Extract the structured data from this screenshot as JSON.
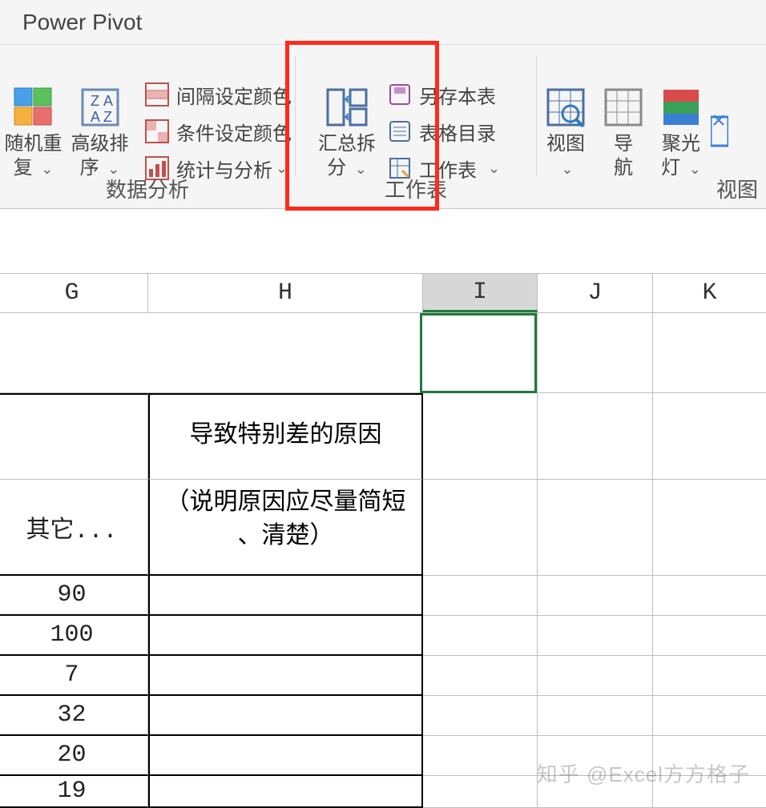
{
  "tab": {
    "title": "Power Pivot"
  },
  "ribbon": {
    "random_repeat": {
      "label": "随机重\n复",
      "dd": "⌄"
    },
    "adv_sort": {
      "label": "高级排\n序",
      "dd": "⌄"
    },
    "interval_color": {
      "label": "间隔设定颜色"
    },
    "cond_color": {
      "label": "条件设定颜色"
    },
    "stat_analyze": {
      "label": "统计与分析",
      "dd": "⌄"
    },
    "group_data": "数据分析",
    "merge_split": {
      "label": "汇总拆\n分",
      "dd": "⌄"
    },
    "save_table": {
      "label": "另存本表"
    },
    "table_toc": {
      "label": "表格目录"
    },
    "worksheet": {
      "label": "工作表",
      "dd": "⌄"
    },
    "group_worksheet": "工作表",
    "view": {
      "label": "视图",
      "dd": "⌄"
    },
    "nav": {
      "label": "导\n航"
    },
    "spotlight": {
      "label": "聚光\n灯",
      "dd": "⌄"
    },
    "group_view": "视图"
  },
  "columns": {
    "G": "G",
    "H": "H",
    "I": "I",
    "J": "J",
    "K": "K"
  },
  "cells": {
    "G_header": "其它...",
    "H_header": "导致特别差的原因\n\n（说明原因应尽量简短\n、清楚）",
    "G_vals": [
      "90",
      "100",
      "7",
      "32",
      "20",
      "19"
    ]
  },
  "watermark": "知乎 @Excel方方格子"
}
